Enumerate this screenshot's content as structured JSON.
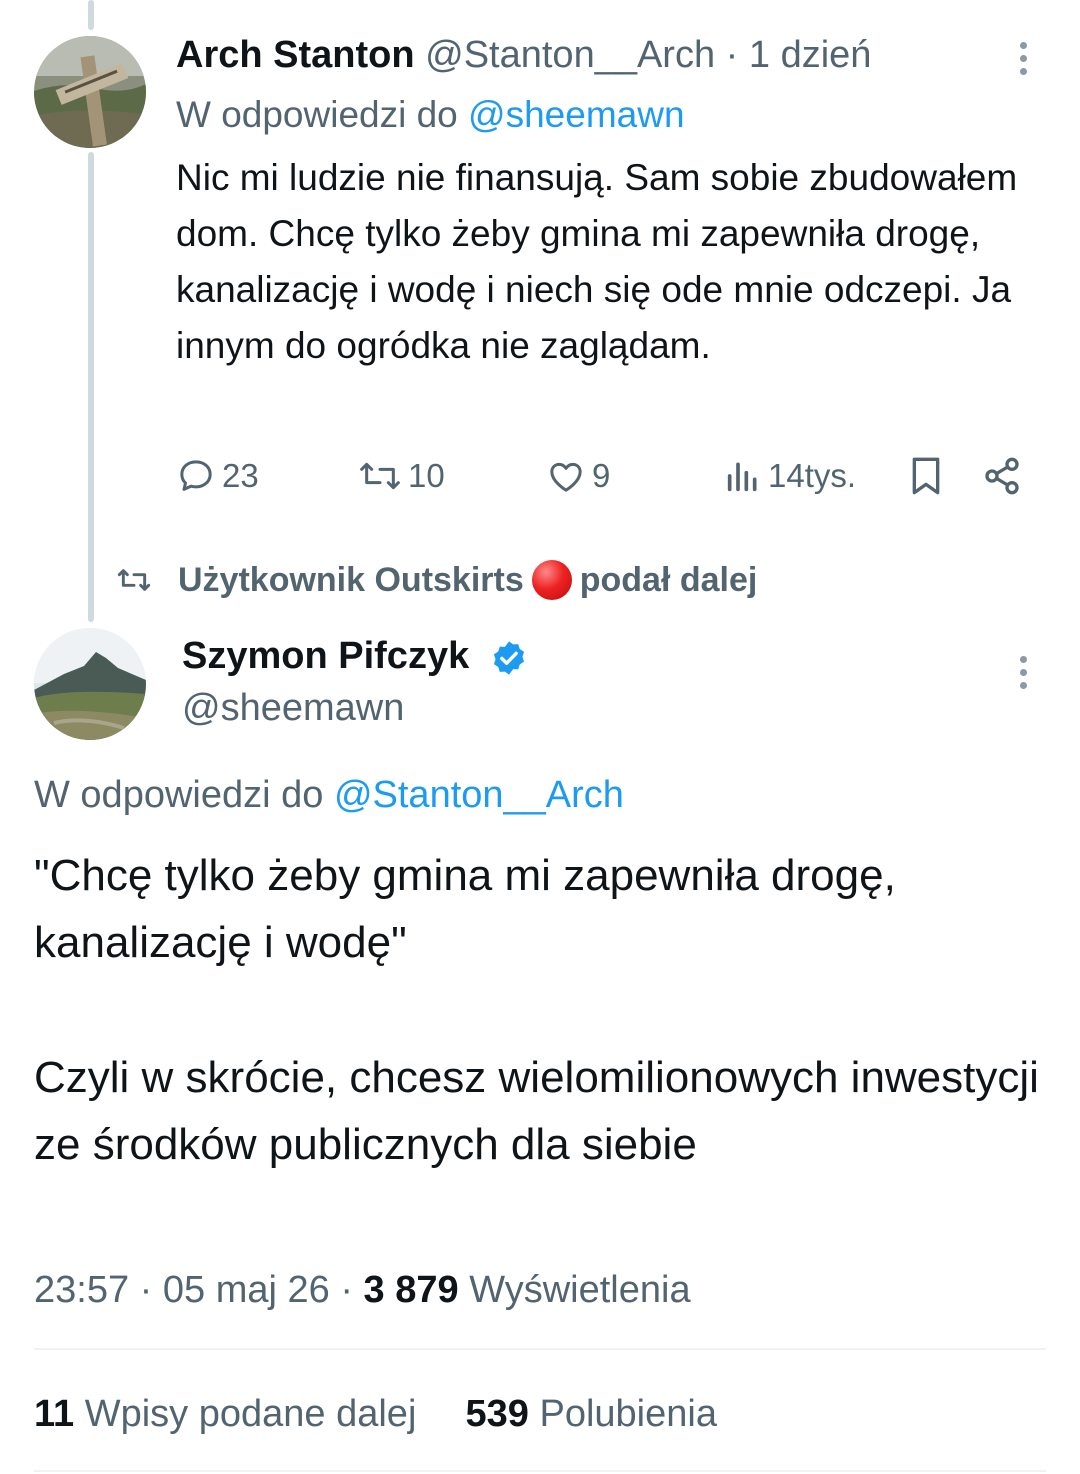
{
  "tweet1": {
    "author_name": "Arch Stanton",
    "author_handle": "@Stanton__Arch",
    "separator": "·",
    "time": "1 dzień",
    "reply_prefix": "W odpowiedzi do",
    "reply_to": "@sheemawn",
    "text": "Nic mi ludzie nie finansują. Sam sobie zbudowałem dom. Chcę tylko żeby gmina mi zapewniła drogę, kanalizację i wodę i niech się ode mnie odczepi. Ja innym do ogródka nie zaglądam.",
    "actions": {
      "replies": "23",
      "reposts": "10",
      "likes": "9",
      "views": "14tys."
    },
    "icons": [
      "reply-icon",
      "repost-icon",
      "like-icon",
      "views-icon",
      "bookmark-icon",
      "share-icon",
      "more-icon"
    ]
  },
  "repost_context": {
    "prefix": "Użytkownik Outskirts",
    "suffix": "podał dalej",
    "emoji_color": "#e82020"
  },
  "tweet2": {
    "author_name": "Szymon Pifczyk",
    "author_handle": "@sheemawn",
    "verified": true,
    "reply_prefix": "W odpowiedzi do",
    "reply_to": "@Stanton__Arch",
    "text_para1": "\"Chcę tylko żeby gmina mi zapewniła drogę, kanalizację i wodę\"",
    "text_para2": "Czyli w skrócie, chcesz wielomilionowych inwestycji ze środków publicznych dla siebie",
    "time": "23:57",
    "date": "05 maj 26",
    "separator": "·",
    "views_count": "3 879",
    "views_label": "Wyświetlenia",
    "reposts_count": "11",
    "reposts_label": "Wpisy podane dalej",
    "likes_count": "539",
    "likes_label": "Polubienia"
  },
  "colors": {
    "text": "#0f1419",
    "secondary": "#536471",
    "link": "#1d9bf0",
    "verified": "#1d9bf0",
    "divider": "#eff3f4"
  }
}
